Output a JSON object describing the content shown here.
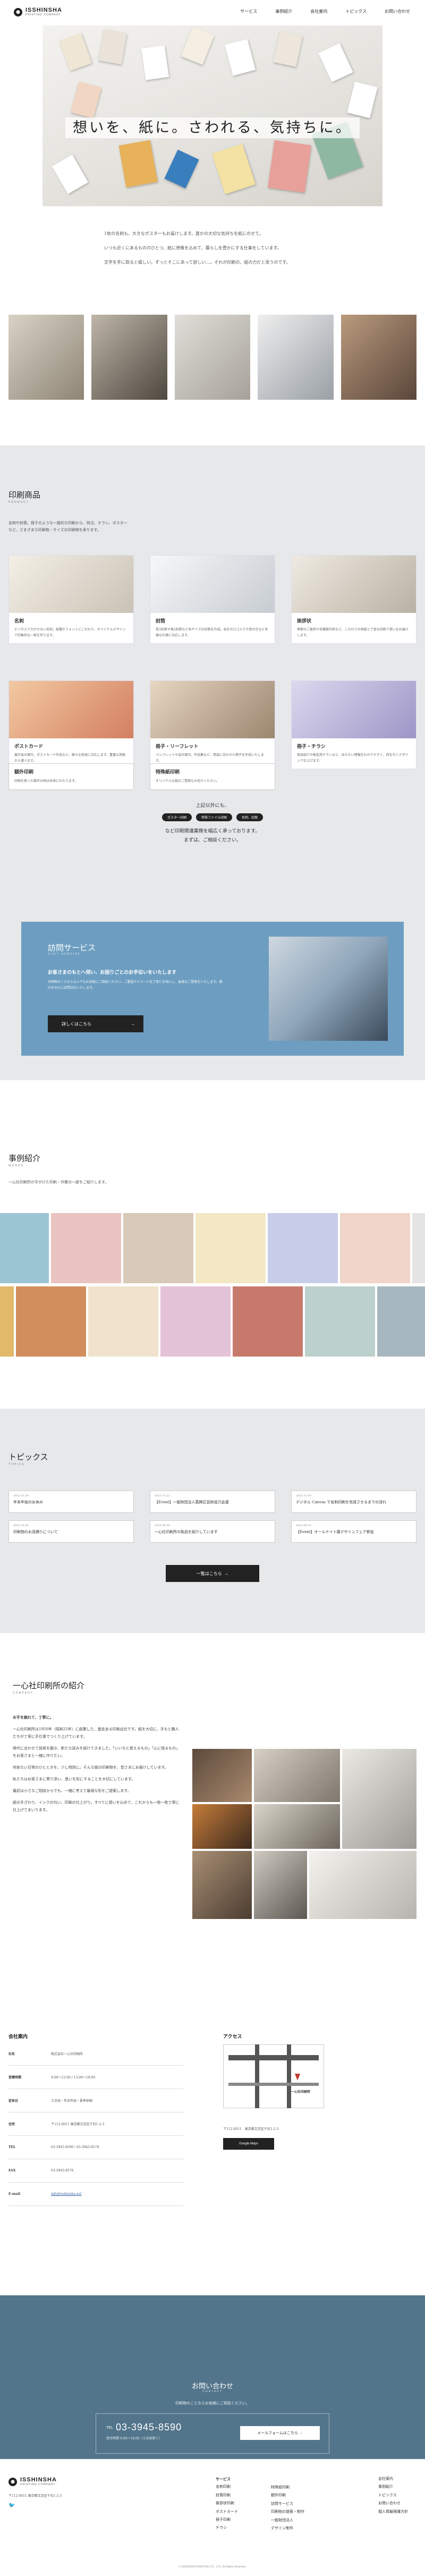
{
  "header": {
    "logo_text": "ISSHINSHA",
    "logo_sub": "PRINTING COMPANY",
    "nav": [
      "サービス",
      "事例紹介",
      "会社案内",
      "トピックス",
      "お問い合わせ"
    ]
  },
  "hero": {
    "title": "想いを、紙に。さわれる、気持ちに。"
  },
  "intro": {
    "paragraphs": [
      "1枚の名刺も、大きなポスターもお届けします。誰かの大切な気持ちを紙にのせて。",
      "いつも近くにあるもののひとつ、紙に想像を込めて、暮らしを豊かにする仕事をしています。",
      "文字を手に取ると嬉しい。ずっとそこにあって欲しい…。それが印刷の、紙の力だと思うのです。"
    ]
  },
  "products": {
    "title": "印刷商品",
    "sub": "PRODUCT",
    "desc": "名刺や封筒、冊子のような一般的な印刷から、特注、チラシ、ポスターなど、さまざまな印刷物・サイズの印刷物を承ります。",
    "items": [
      {
        "name": "名刺",
        "desc": "ビジネスで欠かせない名刺。紙種やフォントにこだわり、オリジナルデザインで印象的な一枚を作ります。"
      },
      {
        "name": "封筒",
        "desc": "長3封筒や角2封筒など各サイズの封筒を作成。会社のロゴ入りや窓付きなど多様な仕様に対応します。"
      },
      {
        "name": "挨拶状",
        "desc": "季節のご挨拶や各種案内状など、こだわりの用紙と丁寧な印刷で想いをお届けします。"
      },
      {
        "name": "ポストカード",
        "desc": "展示会の案内、ポストカード作品など、様々な用途に対応します。豊富な用紙から選べます。"
      },
      {
        "name": "冊子・リーフレット",
        "desc": "パンフレットや会社案内、作品集など、用途に合わせた冊子を作成いたします。"
      },
      {
        "name": "冊子・チラシ",
        "desc": "商品紹介や販促用チラシなど、伝えたい情報をわかりやすく、目を引くデザインで仕上げます。"
      }
    ],
    "small_items": [
      {
        "name": "額外印刷",
        "desc": "印刷を使った製作の例は多岐にわたります。"
      },
      {
        "name": "特殊紙印刷",
        "desc": "オリジナルな紙のご提案もお任せください。"
      }
    ],
    "more_text": "上記以外にも、",
    "tags": [
      "ポスター印刷",
      "特殊ファイル印刷",
      "名刺、封筒"
    ],
    "more_line2": "など印刷関連業務を幅広く承っております。",
    "more_link": "印刷関連業務",
    "more_line3": "まずは、ご相談ください。"
  },
  "visit": {
    "title": "訪問サービス",
    "sub": "VISIT SERVICE",
    "heading": "お客さまのもとへ伺い、お困りごとのお手伝いをいたします",
    "desc": "印刷物のことならなんでもお気軽にご相談ください。ご要望やイメージを丁寧にお伺いし、最適なご提案をいたします。都内を中心に訪問対応いたします。",
    "button": "詳しくはこちら",
    "arrow": "→"
  },
  "works": {
    "title": "事例紹介",
    "sub": "WORKS",
    "desc": "一心社印刷所が手がけた印刷・作業の一部をご紹介します。"
  },
  "topics": {
    "title": "トピックス",
    "sub": "TOPICS",
    "items": [
      {
        "date": "2023.12.28",
        "title": "年末年始のお休み"
      },
      {
        "date": "2023.11.22",
        "title": "【Event】一般財団法人葛飾区芸術協力会議"
      },
      {
        "date": "2023.11.08",
        "title": "デジタル Canvas で名刺印刷を完成させるまでの流れ"
      },
      {
        "date": "2023.10.24",
        "title": "印刷物のお見積りについて"
      },
      {
        "date": "2023.09.30",
        "title": "一心社印刷所の製品を紹介しています"
      },
      {
        "date": "2023.09.14",
        "title": "【Event】オールナイト展デザインフェア参加"
      }
    ],
    "button": "一覧はこちら",
    "arrow": "→"
  },
  "company": {
    "title": "一心社印刷所の紹介",
    "sub": "COMPANY",
    "paragraphs": [
      "お手を触れて、丁寧に。",
      "一心社印刷所は1950年（昭和25年）に創業した、歴史ある印刷会社です。紙を大切に、手もと職人たちが丁寧に手仕事でつくり上げています。",
      "時代に合わせて技術を磨き、新たな試みを続けてきました。「いいなと思えるもの」「心に残るもの」をお客さまと一緒に作りたい。",
      "何気ない日常のひとときを、少し特別に。そんな紙の印刷物を、皆さまにお届けしています。",
      "私たちはお客さまに寄り添い、思いを形にすることを大切にしています。",
      "最初は小さなご相談からでも、一緒に考えて最適な形をご提案します。",
      "紙の手ざわり、インクの匂い、印刷の仕上がり。すべてに想いを込めて、これからも一枚一枚丁寧に仕上げてまいります。"
    ]
  },
  "access": {
    "profile_title": "会社案内",
    "rows": [
      {
        "k": "社名",
        "v": "株式会社一心社印刷所"
      },
      {
        "k": "営業時間",
        "v": "9:00〜12:00 / 13:00〜18:00"
      },
      {
        "k": "定休日",
        "v": "土日祝・年末年始・夏季休暇"
      },
      {
        "k": "住所",
        "v": "〒112-0011 東京都文京区千石1-2-3"
      },
      {
        "k": "TEL",
        "v": "03-3945-8590 / 03-3945-8579"
      },
      {
        "k": "FAX",
        "v": "03-3945-8578"
      },
      {
        "k": "E-mail",
        "v": "info@isshinsha.net"
      }
    ],
    "access_title": "アクセス",
    "map_label": "一心社印刷所",
    "map_address": "〒112-0011　東京都文京区千石1-2-3",
    "map_button": "Google Maps"
  },
  "contact": {
    "title": "お問い合わせ",
    "sub": "CONTACT",
    "desc": "印刷物のことならお気軽にご相談ください。",
    "tel_label": "TEL",
    "tel": "03-3945-8590",
    "hours": "受付時間 9:00〜18:00（土日祝除く）",
    "form_button": "メールフォームはこちら",
    "arrow": "→"
  },
  "footer": {
    "address": "〒112-0011 東京都文京区千石1-2-3",
    "col1_title": "サービス",
    "col1": [
      "名刺印刷",
      "封筒印刷",
      "挨拶状印刷",
      "ポストカード",
      "冊子印刷",
      "チラシ"
    ],
    "col2": [
      "特殊紙印刷",
      "額外印刷",
      "訪問サービス",
      "印刷物の提案・制作",
      "一般財団法人",
      "デザイン制作"
    ],
    "col3": [
      "会社案内",
      "事例紹介",
      "トピックス",
      "お問い合わせ",
      "個人情報保護方針"
    ],
    "copyright": "© ISSHINSHA PRINTING CO., LTD. All Rights Reserved."
  }
}
